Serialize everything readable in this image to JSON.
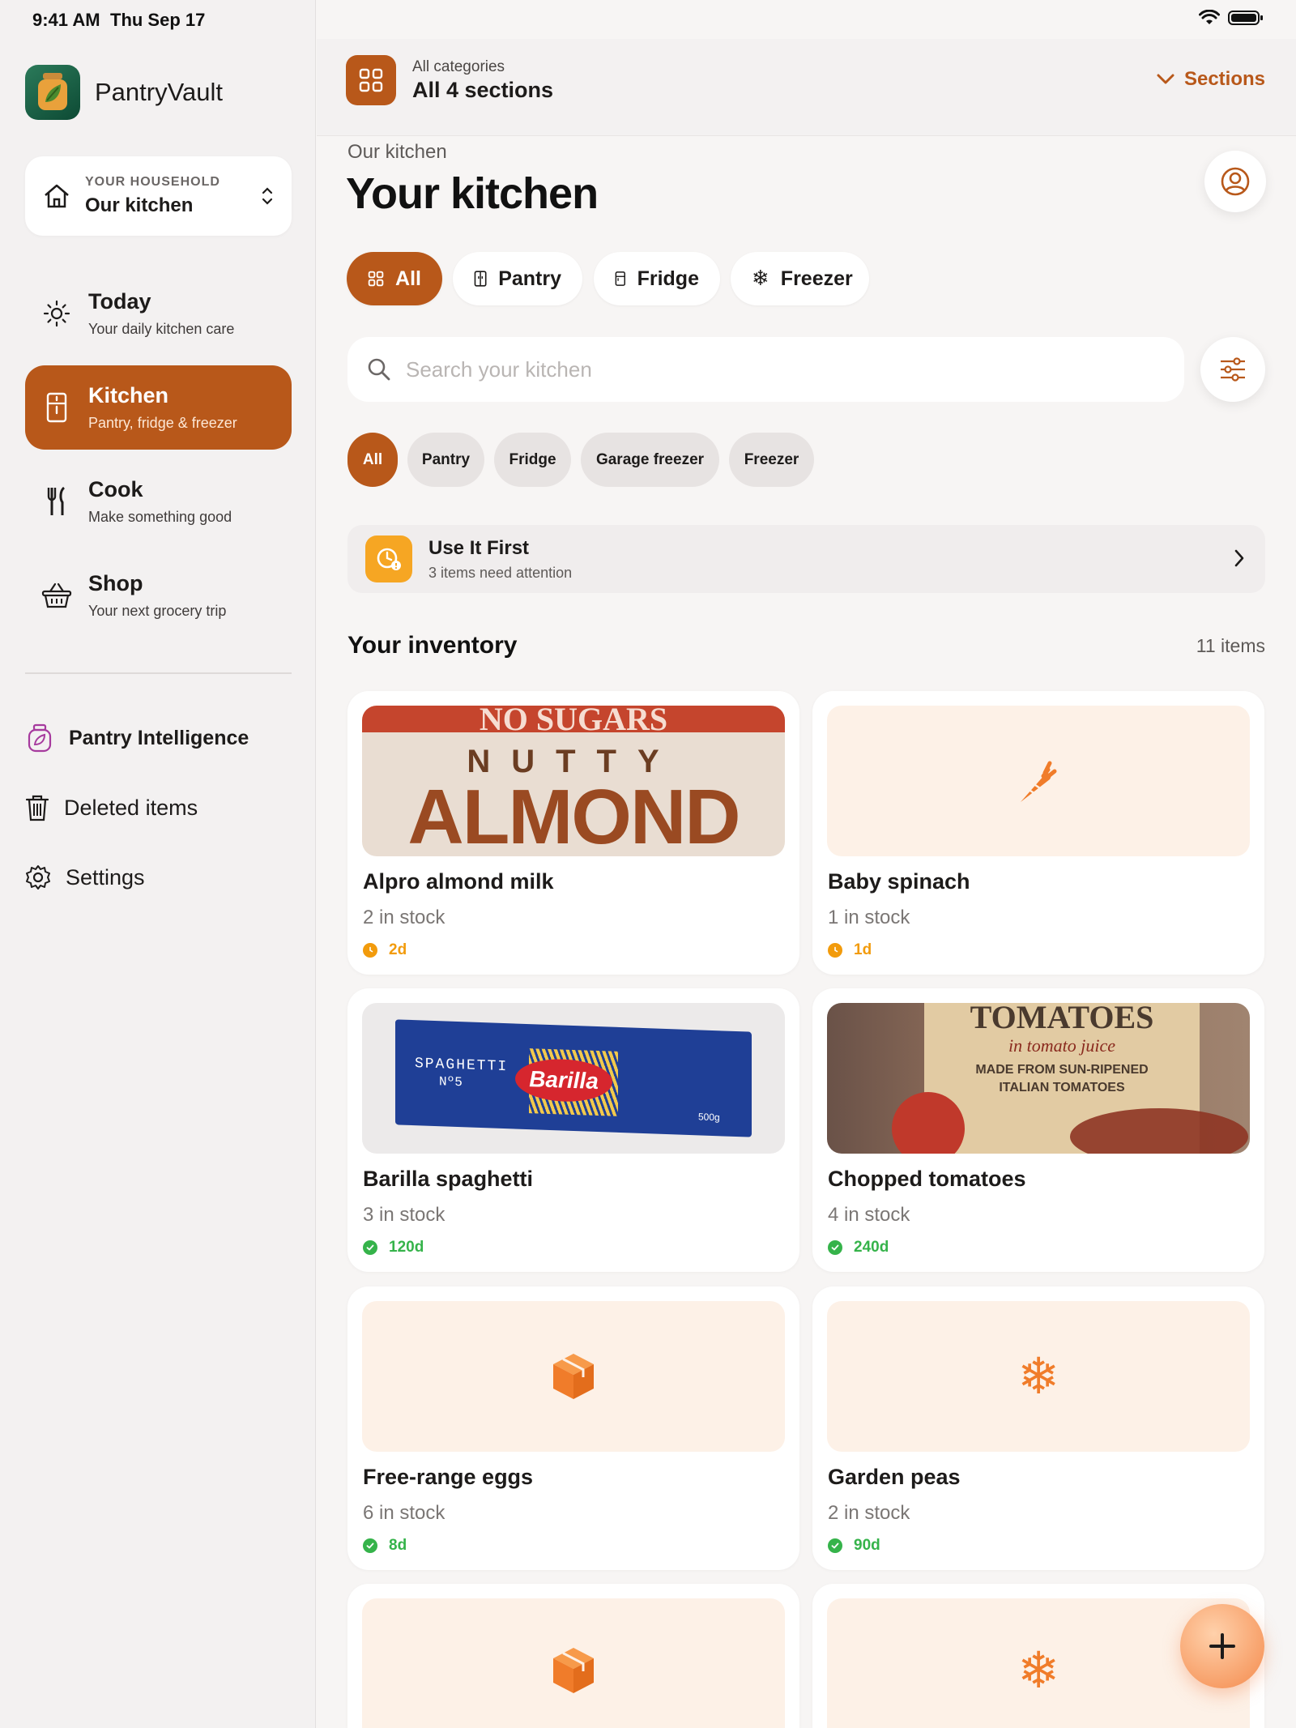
{
  "status": {
    "time": "9:41 AM",
    "date": "Thu Sep 17"
  },
  "brand": {
    "name": "PantryVault"
  },
  "household": {
    "caption": "YOUR HOUSEHOLD",
    "name": "Our kitchen"
  },
  "nav": [
    {
      "title": "Today",
      "subtitle": "Your daily kitchen care",
      "icon": "sun-icon"
    },
    {
      "title": "Kitchen",
      "subtitle": "Pantry, fridge & freezer",
      "icon": "fridge-icon",
      "active": true
    },
    {
      "title": "Cook",
      "subtitle": "Make something good",
      "icon": "fork-knife-icon"
    },
    {
      "title": "Shop",
      "subtitle": "Your next grocery trip",
      "icon": "basket-icon"
    }
  ],
  "secondary_nav": [
    {
      "label": "Pantry Intelligence",
      "icon": "jar-icon"
    },
    {
      "label": "Deleted items",
      "icon": "trash-icon"
    },
    {
      "label": "Settings",
      "icon": "gear-icon"
    }
  ],
  "topbar": {
    "caption": "All categories",
    "title": "All 4 sections",
    "sections_label": "Sections"
  },
  "page": {
    "subtitle": "Our kitchen",
    "title": "Your kitchen"
  },
  "segments": [
    "All",
    "Pantry",
    "Fridge",
    "Freezer"
  ],
  "search": {
    "placeholder": "Search your kitchen"
  },
  "chips": [
    "All",
    "Pantry",
    "Fridge",
    "Garage freezer",
    "Freezer"
  ],
  "use_it_first": {
    "title": "Use It First",
    "subtitle": "3 items need attention"
  },
  "inventory": {
    "title": "Your inventory",
    "count": "11 items",
    "items": [
      {
        "name": "Alpro almond milk",
        "stock": "2 in stock",
        "expiry": "2d",
        "status": "warning",
        "thumb": "almond-milk-photo",
        "photo_text_1": "NO SUGARS",
        "photo_text_2": "NUTTY",
        "photo_text_3": "ALMOND"
      },
      {
        "name": "Baby spinach",
        "stock": "1 in stock",
        "expiry": "1d",
        "status": "warning",
        "thumb": "carrot-icon"
      },
      {
        "name": "Barilla spaghetti",
        "stock": "3 in stock",
        "expiry": "120d",
        "status": "ok",
        "thumb": "spaghetti-photo",
        "photo_text_1": "SPAGHETTI",
        "photo_text_2": "Nº5",
        "photo_text_3": "Barilla",
        "photo_text_4": "500g"
      },
      {
        "name": "Chopped tomatoes",
        "stock": "4 in stock",
        "expiry": "240d",
        "status": "ok",
        "thumb": "tomatoes-photo",
        "photo_text_1": "TOMATOES",
        "photo_text_2": "in tomato juice",
        "photo_text_3": "MADE FROM SUN-RIPENED",
        "photo_text_4": "ITALIAN TOMATOES"
      },
      {
        "name": "Free-range eggs",
        "stock": "6 in stock",
        "expiry": "8d",
        "status": "ok",
        "thumb": "box-icon"
      },
      {
        "name": "Garden peas",
        "stock": "2 in stock",
        "expiry": "90d",
        "status": "ok",
        "thumb": "snowflake-icon"
      }
    ]
  },
  "colors": {
    "accent": "#b8581a",
    "warning": "#f29b0c",
    "ok": "#35b34a",
    "icon_orange": "#f07c2a"
  }
}
